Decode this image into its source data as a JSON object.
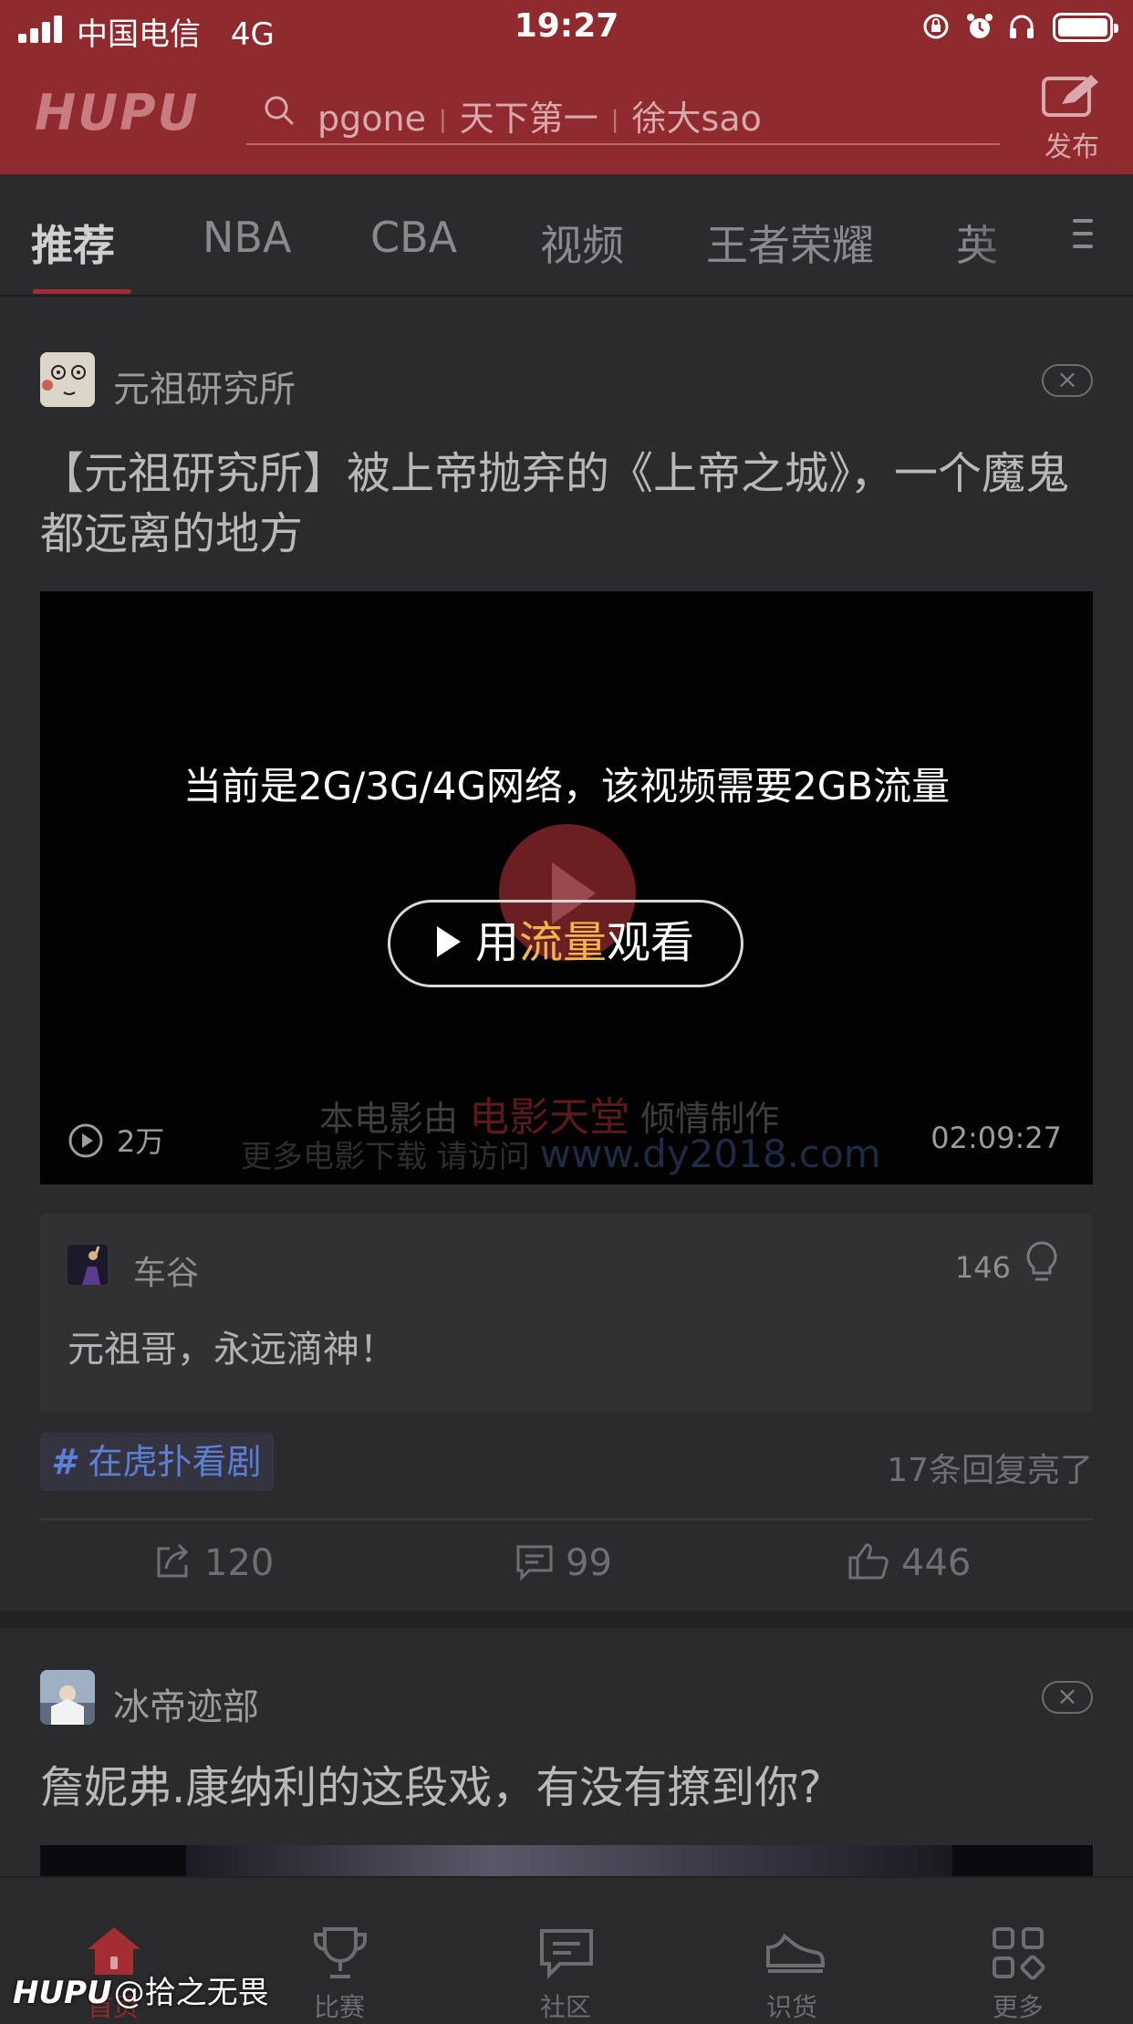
{
  "status_bar": {
    "carrier": "中国电信",
    "network": "4G",
    "time": "19:27"
  },
  "header": {
    "logo": "HUPU",
    "search_terms": [
      "pgone",
      "天下第一",
      "徐大sao"
    ],
    "search_separator": "|",
    "publish_label": "发布",
    "colors": {
      "header_bg": "#8f2b2f",
      "accent": "#a32d32"
    }
  },
  "tabs": {
    "items": [
      "推荐",
      "NBA",
      "CBA",
      "视频",
      "王者荣耀",
      "英"
    ],
    "active_index": 0
  },
  "post1": {
    "author": "元祖研究所",
    "close_icon": "×",
    "title": "【元祖研究所】被上帝抛弃的《上帝之城》，一个魔鬼都远离的地方",
    "video": {
      "network_warning": "当前是2G/3G/4G网络，该视频需要2GB流量",
      "watch_prefix": "用",
      "watch_highlight": "流量",
      "watch_suffix": "观看",
      "watermark_line1_a": "本电影由",
      "watermark_line1_b": "电影天堂",
      "watermark_line1_c": "倾情制作",
      "watermark_line2_a": "更多电影下载 请访问",
      "watermark_line2_b": "www.dy2018.com",
      "views": "2万",
      "duration": "02:09:27"
    },
    "top_comment": {
      "user": "车谷",
      "likes": "146",
      "text": "元祖哥，永远滴神！"
    },
    "topic_tag": "在虎扑看剧",
    "reply_status": "17条回复亮了",
    "actions": {
      "share": "120",
      "comments": "99",
      "likes": "446"
    }
  },
  "post2": {
    "author": "冰帝迹部",
    "close_icon": "×",
    "title": "詹妮弗.康纳利的这段戏，有没有撩到你?"
  },
  "bottom_tabs": {
    "items": [
      {
        "label": "首页",
        "icon": "home-icon"
      },
      {
        "label": "比赛",
        "icon": "trophy-icon"
      },
      {
        "label": "社区",
        "icon": "chat-icon"
      },
      {
        "label": "识货",
        "icon": "sneaker-icon"
      },
      {
        "label": "更多",
        "icon": "grid-icon"
      }
    ],
    "active_index": 0
  },
  "watermark": {
    "logo": "HUPU",
    "handle": "@拾之无畏"
  }
}
